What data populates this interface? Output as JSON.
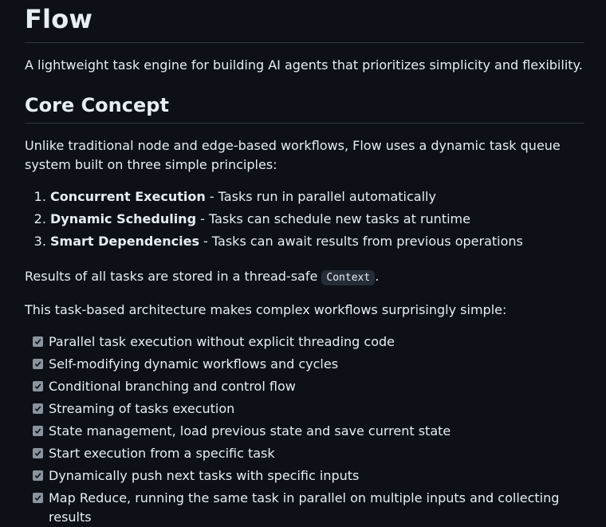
{
  "title": "Flow",
  "intro": "A lightweight task engine for building AI agents that prioritizes simplicity and flexibility.",
  "core_concept": {
    "heading": "Core Concept",
    "paragraph": "Unlike traditional node and edge-based workflows, Flow uses a dynamic task queue system built on three simple principles:",
    "principles": [
      {
        "number": "1.",
        "term": "Concurrent Execution",
        "desc": " - Tasks run in parallel automatically"
      },
      {
        "number": "2.",
        "term": "Dynamic Scheduling",
        "desc": " - Tasks can schedule new tasks at runtime"
      },
      {
        "number": "3.",
        "term": "Smart Dependencies",
        "desc": " - Tasks can await results from previous operations"
      }
    ],
    "results_before": "Results of all tasks are stored in a thread-safe ",
    "results_code": "Context",
    "results_after": ".",
    "architecture": "This task-based architecture makes complex workflows surprisingly simple:",
    "features": [
      {
        "text": "Parallel task execution without explicit threading code",
        "checked": true
      },
      {
        "text": "Self-modifying dynamic workflows and cycles",
        "checked": true
      },
      {
        "text": "Conditional branching and control flow",
        "checked": true
      },
      {
        "text": "Streaming of tasks execution",
        "checked": true
      },
      {
        "text": "State management, load previous state and save current state",
        "checked": true
      },
      {
        "text": "Start execution from a specific task",
        "checked": true
      },
      {
        "text": "Dynamically push next tasks with specific inputs",
        "checked": true
      },
      {
        "text": "Map Reduce, running the same task in parallel on multiple inputs and collecting results",
        "checked": true
      }
    ]
  },
  "colors": {
    "background": "#0d1117",
    "text": "#e6edf3",
    "divider": "#30363d",
    "checkbox": "#8b949e"
  }
}
